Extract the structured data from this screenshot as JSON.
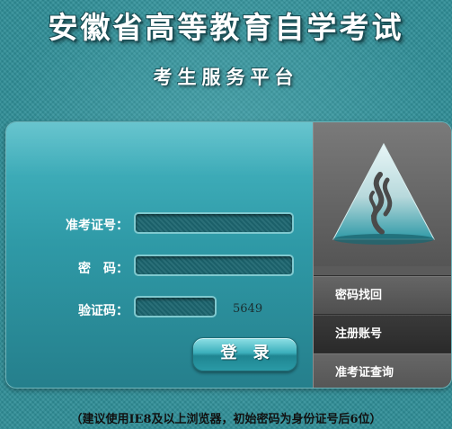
{
  "header": {
    "title": "安徽省高等教育自学考试",
    "subtitle": "考生服务平台"
  },
  "login_form": {
    "exam_id_label": "准考证号：",
    "exam_id_value": "",
    "password_label": "密　码：",
    "password_value": "",
    "captcha_label": "验证码：",
    "captcha_value": "",
    "captcha_code": "5649",
    "login_button": "登录"
  },
  "side_menu": {
    "logo_icon": "education-logo-icon",
    "items": [
      {
        "label": "密码找回"
      },
      {
        "label": "注册账号"
      },
      {
        "label": "准考证查询"
      }
    ]
  },
  "footer": {
    "note": "（建议使用IE8及以上浏览器，初始密码为身份证号后6位）"
  },
  "colors": {
    "background": "#2f8e97",
    "panel": "#3aa8b4",
    "side_panel": "#5b5b5b",
    "text_light": "#ffffff"
  }
}
